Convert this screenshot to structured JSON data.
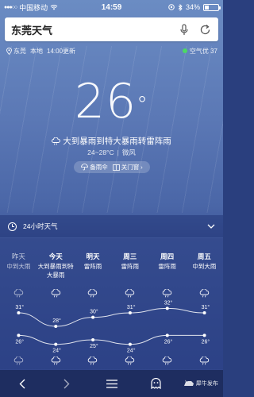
{
  "status_bar": {
    "carrier": "中国移动",
    "time": "14:59",
    "battery": "34%",
    "battery_level": 0.34
  },
  "search": {
    "value": "东莞天气"
  },
  "location": {
    "city": "东莞",
    "scope": "本地",
    "updated": "14:00更新",
    "aqi_text": "空气优 37",
    "aqi_color": "#4cd964"
  },
  "current": {
    "temp": "26",
    "degree": "°",
    "condition": "大到暴雨到特大暴雨转雷阵雨",
    "range": "24~28°C",
    "wind": "微风",
    "umbrella": "备雨伞",
    "windows": "关门窗",
    "pill_arrow": "›"
  },
  "hourly": {
    "label": "24小时天气",
    "chevron": "⌄"
  },
  "forecast": {
    "days": [
      {
        "name": "昨天",
        "desc": "中到大雨",
        "past": true
      },
      {
        "name": "今天",
        "desc": "大到暴雨到特大暴雨",
        "past": false
      },
      {
        "name": "明天",
        "desc": "雷阵雨",
        "past": false
      },
      {
        "name": "周三",
        "desc": "雷阵雨",
        "past": false
      },
      {
        "name": "周四",
        "desc": "雷阵雨",
        "past": false
      },
      {
        "name": "周五",
        "desc": "中到大雨",
        "past": false
      }
    ],
    "high_labels": [
      "31°",
      "28°",
      "30°",
      "31°",
      "32°",
      "31°"
    ],
    "low_labels": [
      "26°",
      "24°",
      "25°",
      "24°",
      "26°",
      "26°"
    ]
  },
  "chart_data": {
    "type": "line",
    "categories": [
      "昨天",
      "今天",
      "明天",
      "周三",
      "周四",
      "周五"
    ],
    "series": [
      {
        "values": [
          31,
          28,
          30,
          31,
          32,
          31
        ]
      },
      {
        "values": [
          26,
          24,
          25,
          24,
          26,
          26
        ]
      }
    ]
  },
  "bottom_nav": {
    "watermark": "犀牛发布"
  }
}
